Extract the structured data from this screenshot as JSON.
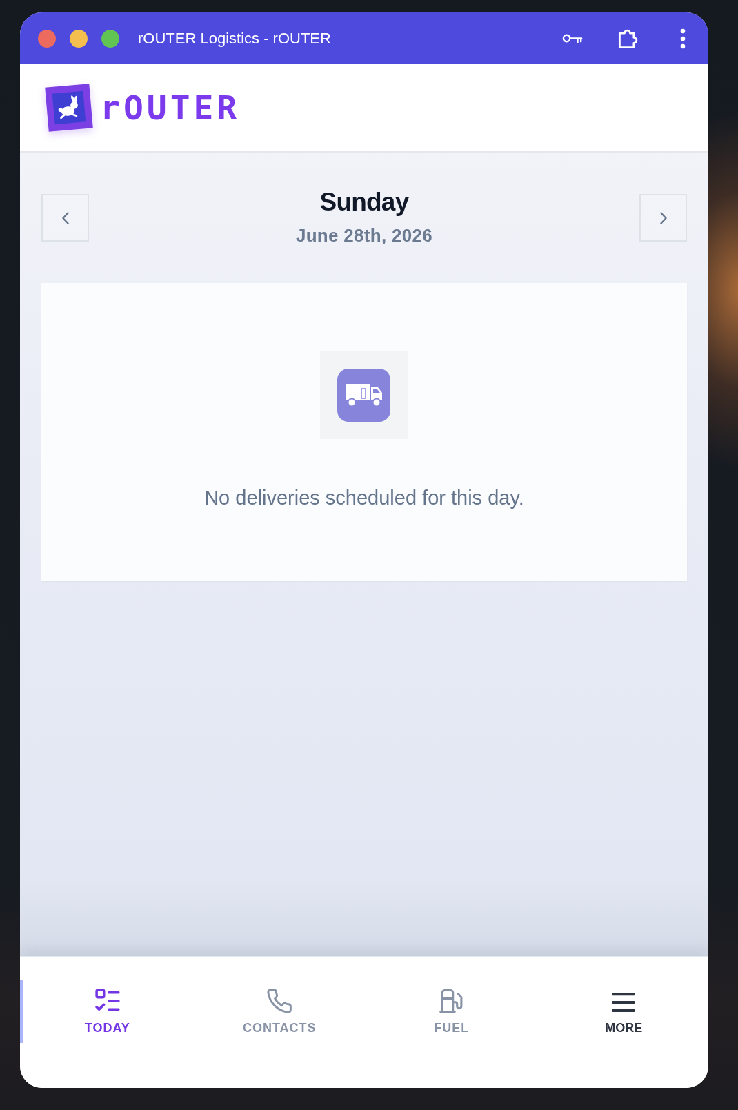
{
  "window": {
    "title": "rOUTER Logistics - rOUTER"
  },
  "header": {
    "brand": "rOUTER"
  },
  "date_nav": {
    "day": "Sunday",
    "date": "June 28th, 2026"
  },
  "empty_state": {
    "message": "No deliveries scheduled for this day."
  },
  "bottom_nav": {
    "items": [
      {
        "label": "TODAY",
        "kind": "tab",
        "selected": true
      },
      {
        "label": "CONTACTS",
        "kind": "tab",
        "selected": false
      },
      {
        "label": "FUEL",
        "kind": "tab",
        "selected": false
      },
      {
        "label": "MORE",
        "kind": "menu",
        "selected": false
      }
    ]
  }
}
